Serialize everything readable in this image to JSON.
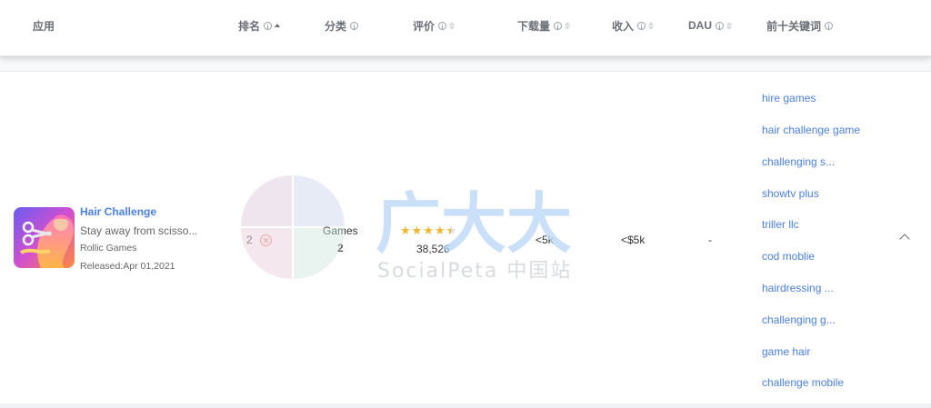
{
  "columns": [
    {
      "label": "应用"
    },
    {
      "label": "排名"
    },
    {
      "label": "分类"
    },
    {
      "label": "评价"
    },
    {
      "label": "下载量"
    },
    {
      "label": "收入"
    },
    {
      "label": "DAU"
    },
    {
      "label": "前十关键词"
    }
  ],
  "app": {
    "name": "Hair Challenge",
    "description": "Stay away from scisso...",
    "developer": "Rollic Games",
    "released": "Released:Apr 01,2021",
    "rank": "2",
    "category": "Games",
    "category_rank": "2",
    "rating_stars": 4.5,
    "rating_count": "38,526",
    "downloads": "<5k",
    "revenue": "<$5k",
    "dau": "-"
  },
  "keywords": [
    "hire games",
    "hair challenge game",
    "challenging s...",
    "showtv plus",
    "triller llc",
    "cod moblie",
    "hairdressing ...",
    "challenging g...",
    "game hair",
    "challenge mobile"
  ],
  "watermark": {
    "cn_title": "广大大",
    "subtitle": "SocialPeta 中国站"
  },
  "colors": {
    "link": "#4a80e8",
    "star": "#f3b52c",
    "remove": "#f08a72"
  },
  "icons": {
    "info": "info-icon",
    "sort": "sort-icon",
    "remove": "remove-icon",
    "collapse": "chevron-up-icon"
  }
}
